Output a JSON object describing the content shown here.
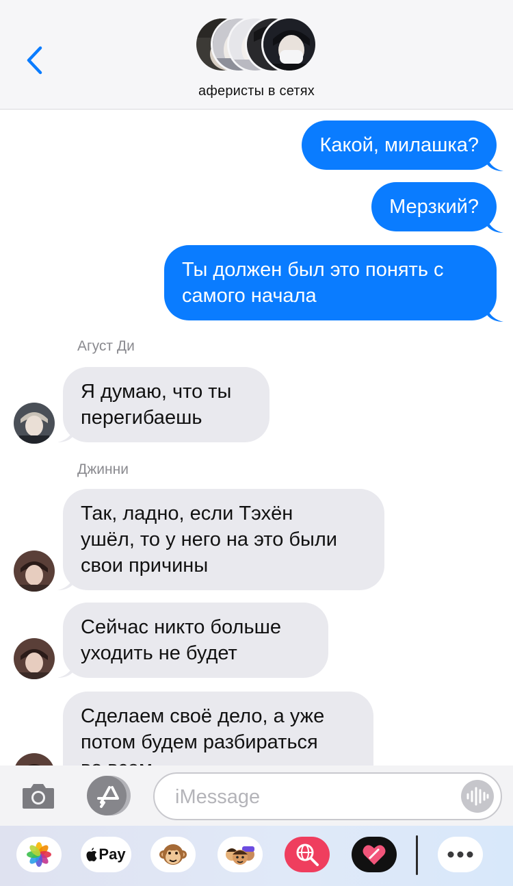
{
  "header": {
    "group_name": "аферисты в сетях"
  },
  "messages": {
    "out1": "Какой, милашка?",
    "out2": "Мерзкий?",
    "out3_line1": "Ты должен был это понять с",
    "out3_line2": "самого начала",
    "sender1": "Агуст Ди",
    "in1_line1": "Я думаю, что ты",
    "in1_line2": "перегибаешь",
    "sender2": "Джинни",
    "in2_line1": "Так, ладно, если Тэхён",
    "in2_line2": "ушёл, то у него на это были",
    "in2_line3": "свои причины",
    "in3_line1": "Сейчас никто больше",
    "in3_line2": "уходить не будет",
    "in4_line1": "Сделаем своё дело, а уже",
    "in4_line2": "потом будем разбираться",
    "in4_line3": "во всем"
  },
  "input": {
    "placeholder": "iMessage"
  },
  "apps": {
    "pay_label": "Pay"
  },
  "colors": {
    "outgoing_bubble": "#0a7cff",
    "incoming_bubble": "#e9e9ee",
    "accent": "#0a7cff"
  }
}
